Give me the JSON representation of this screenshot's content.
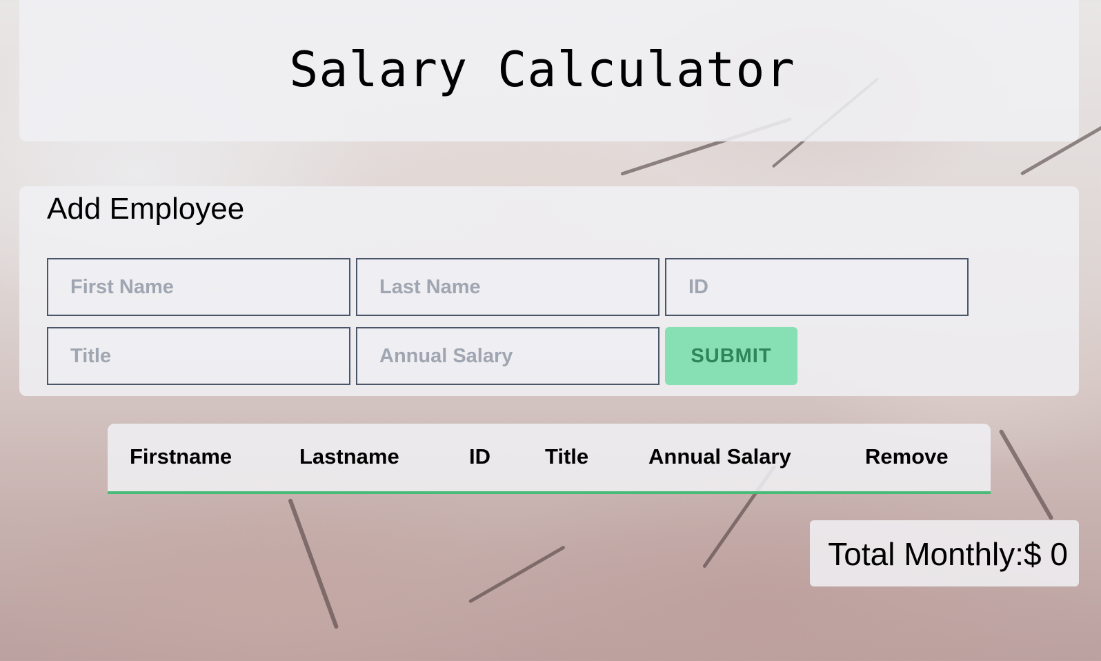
{
  "header": {
    "title": "Salary Calculator"
  },
  "form": {
    "title": "Add Employee",
    "first_name": {
      "placeholder": "First Name",
      "value": ""
    },
    "last_name": {
      "placeholder": "Last Name",
      "value": ""
    },
    "id": {
      "placeholder": "ID",
      "value": ""
    },
    "title_field": {
      "placeholder": "Title",
      "value": ""
    },
    "annual_salary": {
      "placeholder": "Annual Salary",
      "value": ""
    },
    "submit_label": "SUBMIT"
  },
  "table": {
    "columns": [
      "Firstname",
      "Lastname",
      "ID",
      "Title",
      "Annual Salary",
      "Remove"
    ],
    "rows": []
  },
  "total": {
    "text": "Total Monthly:$ 0",
    "amount": 0
  },
  "colors": {
    "submit_background": "#86e0b3",
    "submit_text": "#2f855a",
    "table_underline": "#48bb78",
    "panel": "#f0f0f3"
  },
  "background": {
    "icon": "cherry-blossom-photo"
  }
}
